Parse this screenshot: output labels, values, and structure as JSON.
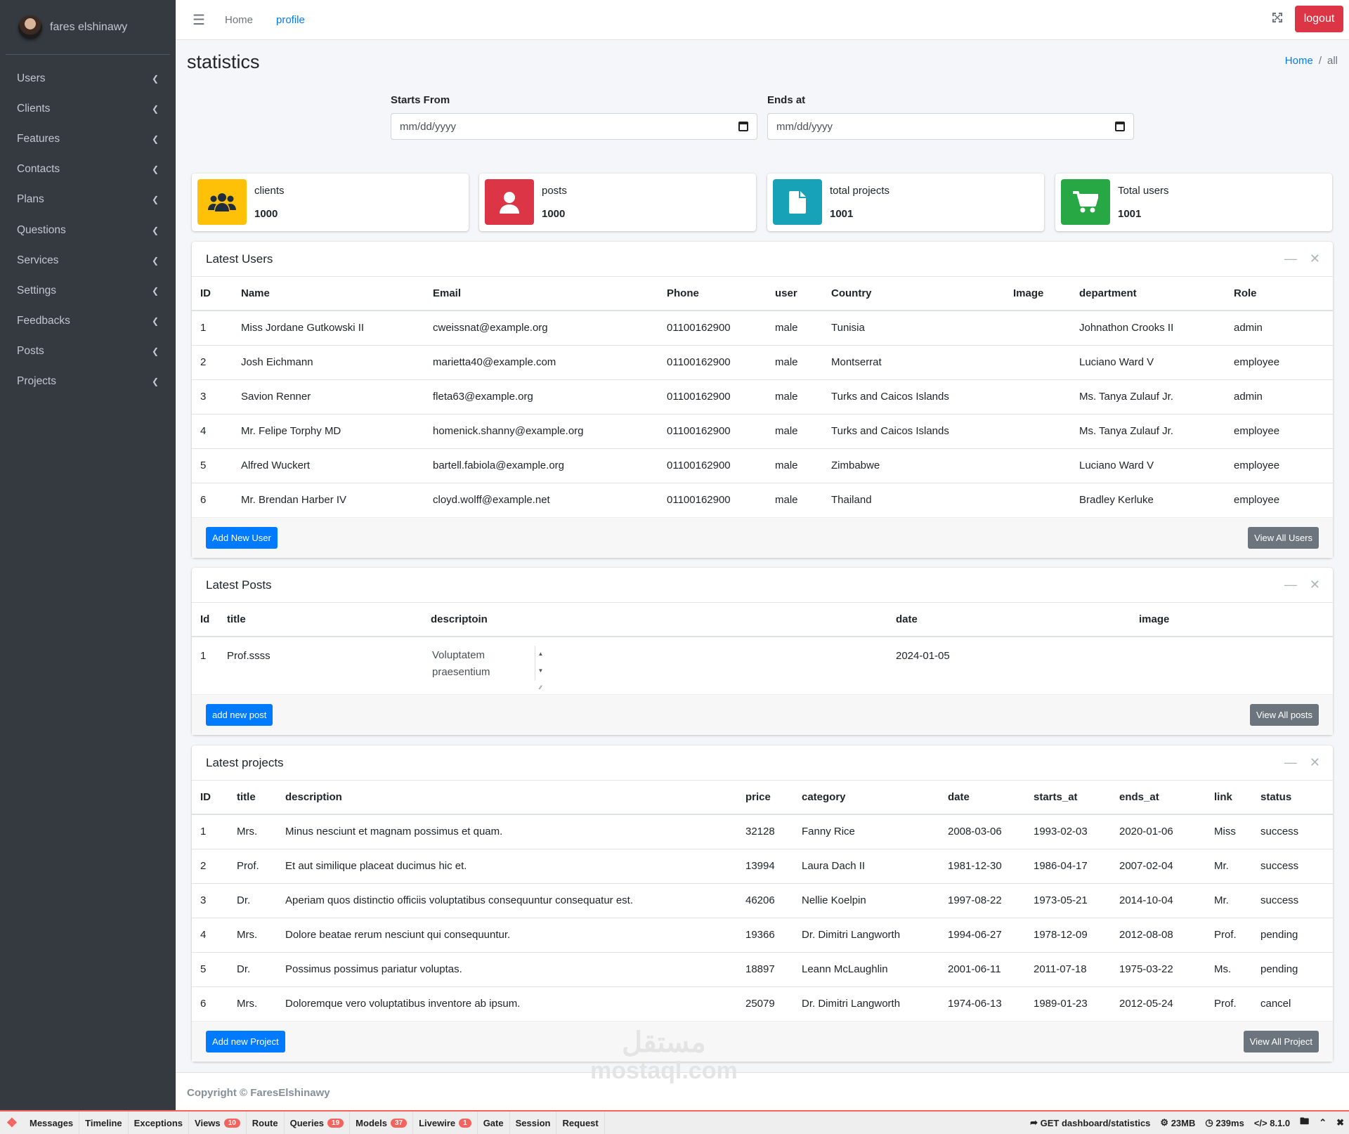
{
  "sidebar": {
    "user_name": "fares elshinawy",
    "items": [
      {
        "label": "Users"
      },
      {
        "label": "Clients"
      },
      {
        "label": "Features"
      },
      {
        "label": "Contacts"
      },
      {
        "label": "Plans"
      },
      {
        "label": "Questions"
      },
      {
        "label": "Services"
      },
      {
        "label": "Settings"
      },
      {
        "label": "Feedbacks"
      },
      {
        "label": "Posts"
      },
      {
        "label": "Projects"
      }
    ]
  },
  "topnav": {
    "home": "Home",
    "profile": "profile",
    "logout": "logout"
  },
  "page": {
    "title": "statistics",
    "breadcrumb_home": "Home",
    "breadcrumb_separator": "/",
    "breadcrumb_current": "all"
  },
  "filters": {
    "starts_label": "Starts From",
    "starts_placeholder": "mm/dd/yyyy",
    "ends_label": "Ends at",
    "ends_placeholder": "mm/dd/yyyy"
  },
  "info_boxes": [
    {
      "label": "clients",
      "value": "1000",
      "color": "#ffc107",
      "icon": "users-icon"
    },
    {
      "label": "posts",
      "value": "1000",
      "color": "#dc3545",
      "icon": "user-icon"
    },
    {
      "label": "total projects",
      "value": "1001",
      "color": "#17a2b8",
      "icon": "file-icon"
    },
    {
      "label": "Total users",
      "value": "1001",
      "color": "#28a745",
      "icon": "cart-icon"
    }
  ],
  "latest_users": {
    "title": "Latest Users",
    "columns": [
      "ID",
      "Name",
      "Email",
      "Phone",
      "user",
      "Country",
      "Image",
      "department",
      "Role"
    ],
    "rows": [
      [
        "1",
        "Miss Jordane Gutkowski II",
        "cweissnat@example.org",
        "01100162900",
        "male",
        "Tunisia",
        "",
        "Johnathon Crooks II",
        "admin"
      ],
      [
        "2",
        "Josh Eichmann",
        "marietta40@example.com",
        "01100162900",
        "male",
        "Montserrat",
        "",
        "Luciano Ward V",
        "employee"
      ],
      [
        "3",
        "Savion Renner",
        "fleta63@example.org",
        "01100162900",
        "male",
        "Turks and Caicos Islands",
        "",
        "Ms. Tanya Zulauf Jr.",
        "admin"
      ],
      [
        "4",
        "Mr. Felipe Torphy MD",
        "homenick.shanny@example.org",
        "01100162900",
        "male",
        "Turks and Caicos Islands",
        "",
        "Ms. Tanya Zulauf Jr.",
        "employee"
      ],
      [
        "5",
        "Alfred Wuckert",
        "bartell.fabiola@example.org",
        "01100162900",
        "male",
        "Zimbabwe",
        "",
        "Luciano Ward V",
        "employee"
      ],
      [
        "6",
        "Mr. Brendan Harber IV",
        "cloyd.wolff@example.net",
        "01100162900",
        "male",
        "Thailand",
        "",
        "Bradley Kerluke",
        "employee"
      ]
    ],
    "add_button": "Add New User",
    "view_button": "View All Users"
  },
  "latest_posts": {
    "title": "Latest Posts",
    "columns": [
      "Id",
      "title",
      "descriptoin",
      "date",
      "image"
    ],
    "rows": [
      {
        "id": "1",
        "title": "Prof.ssss",
        "description": "Voluptatem praesentium",
        "date": "2024-01-05",
        "image": ""
      }
    ],
    "add_button": "add new post",
    "view_button": "View All posts"
  },
  "latest_projects": {
    "title": "Latest projects",
    "columns": [
      "ID",
      "title",
      "description",
      "price",
      "category",
      "date",
      "starts_at",
      "ends_at",
      "link",
      "status"
    ],
    "rows": [
      [
        "1",
        "Mrs.",
        "Minus nesciunt et magnam possimus et quam.",
        "32128",
        "Fanny Rice",
        "2008-03-06",
        "1993-02-03",
        "2020-01-06",
        "Miss",
        "success"
      ],
      [
        "2",
        "Prof.",
        "Et aut similique placeat ducimus hic et.",
        "13994",
        "Laura Dach II",
        "1981-12-30",
        "1986-04-17",
        "2007-02-04",
        "Mr.",
        "success"
      ],
      [
        "3",
        "Dr.",
        "Aperiam quos distinctio officiis voluptatibus consequuntur consequatur est.",
        "46206",
        "Nellie Koelpin",
        "1997-08-22",
        "1973-05-21",
        "2014-10-04",
        "Mr.",
        "success"
      ],
      [
        "4",
        "Mrs.",
        "Dolore beatae rerum nesciunt qui consequuntur.",
        "19366",
        "Dr. Dimitri Langworth",
        "1994-06-27",
        "1978-12-09",
        "2012-08-08",
        "Prof.",
        "pending"
      ],
      [
        "5",
        "Dr.",
        "Possimus possimus pariatur voluptas.",
        "18897",
        "Leann McLaughlin",
        "2001-06-11",
        "2011-07-18",
        "1975-03-22",
        "Ms.",
        "pending"
      ],
      [
        "6",
        "Mrs.",
        "Doloremque vero voluptatibus inventore ab ipsum.",
        "25079",
        "Dr. Dimitri Langworth",
        "1974-06-13",
        "1989-01-23",
        "2012-05-24",
        "Prof.",
        "cancel"
      ]
    ],
    "add_button": "Add new Project",
    "view_button": "View All Project"
  },
  "footer": {
    "copyright": "Copyright © FaresElshinawy"
  },
  "watermark": {
    "line1": "مستقل",
    "line2": "mostaql.com"
  },
  "debugbar": {
    "tabs": [
      {
        "label": "Messages",
        "badge": ""
      },
      {
        "label": "Timeline",
        "badge": ""
      },
      {
        "label": "Exceptions",
        "badge": ""
      },
      {
        "label": "Views",
        "badge": "10"
      },
      {
        "label": "Route",
        "badge": ""
      },
      {
        "label": "Queries",
        "badge": "19"
      },
      {
        "label": "Models",
        "badge": "37"
      },
      {
        "label": "Livewire",
        "badge": "1"
      },
      {
        "label": "Gate",
        "badge": ""
      },
      {
        "label": "Session",
        "badge": ""
      },
      {
        "label": "Request",
        "badge": ""
      }
    ],
    "route": "GET dashboard/statistics",
    "memory": "23MB",
    "time": "239ms",
    "php": "8.1.0"
  }
}
